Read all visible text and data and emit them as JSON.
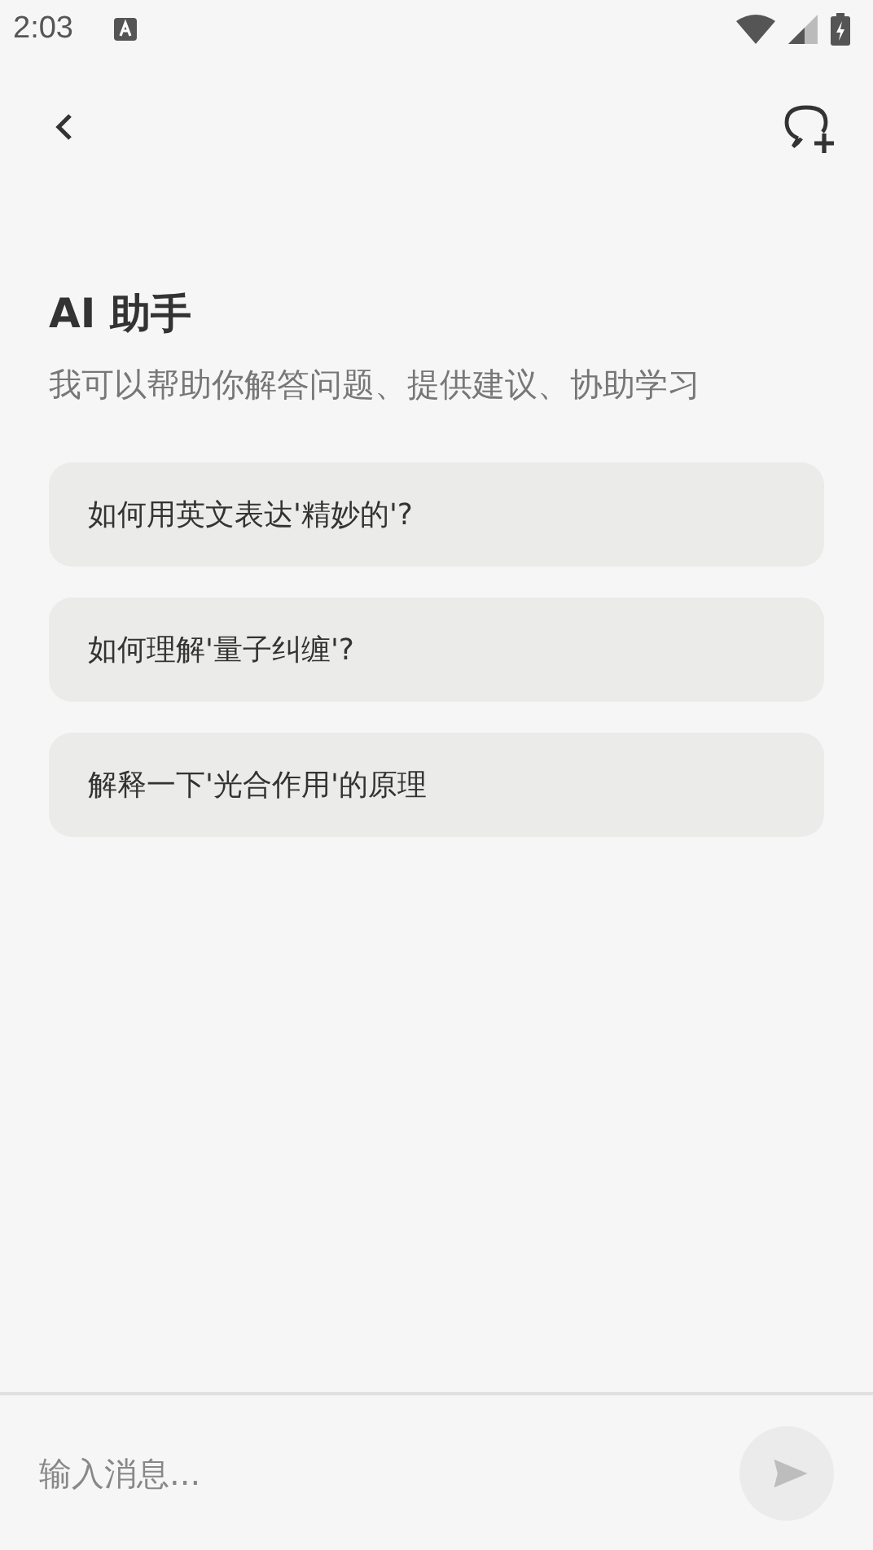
{
  "status_bar": {
    "time": "2:03"
  },
  "header": {
    "title": "AI 助手",
    "subtitle": "我可以帮助你解答问题、提供建议、协助学习"
  },
  "suggestions": [
    {
      "text": "如何用英文表达'精妙的'?"
    },
    {
      "text": "如何理解'量子纠缠'?"
    },
    {
      "text": "解释一下'光合作用'的原理"
    }
  ],
  "composer": {
    "placeholder": "输入消息..."
  }
}
